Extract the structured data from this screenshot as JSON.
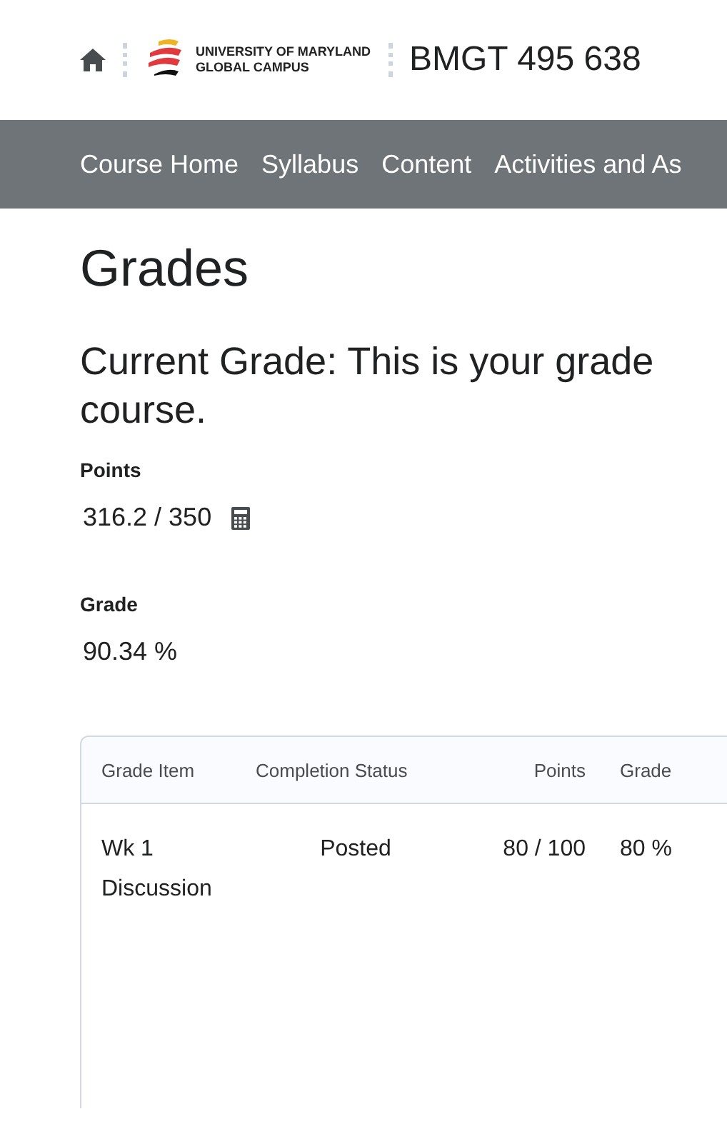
{
  "header": {
    "logo_lines": [
      "UNIVERSITY OF MARYLAND",
      "GLOBAL CAMPUS"
    ],
    "course_title": "BMGT 495 638"
  },
  "nav": [
    {
      "label": "Course Home"
    },
    {
      "label": "Syllabus"
    },
    {
      "label": "Content"
    },
    {
      "label": "Activities and As"
    }
  ],
  "page_title": "Grades",
  "heading_lines": [
    "Current Grade: This is your grade",
    "course."
  ],
  "summary": [
    {
      "label": "Points",
      "value": "316.2 / 350",
      "calculator": true
    },
    {
      "label": "Grade",
      "value": "90.34 %",
      "calculator": false
    }
  ],
  "table": {
    "columns": [
      {
        "label": "Grade Item"
      },
      {
        "label": "Completion Status"
      },
      {
        "label": "Points"
      },
      {
        "label": "Grade"
      }
    ],
    "rows": [
      {
        "cells": [
          "Wk 1 Discussion",
          "Posted",
          "80 / 100",
          "80 %"
        ]
      }
    ]
  }
}
